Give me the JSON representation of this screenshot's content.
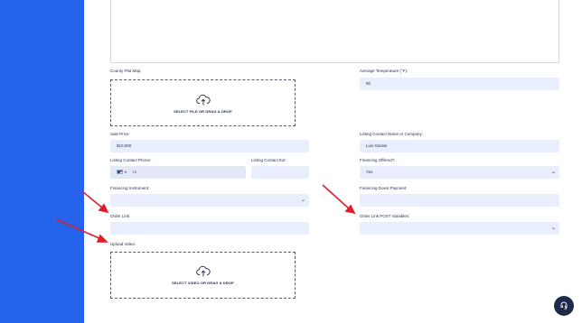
{
  "form": {
    "county_plat_map": {
      "label": "County Plat Map:",
      "dropzone_text": "SELECT FILE OR DRAG & DROP"
    },
    "average_temperature": {
      "label": "Average Temperature (°F):",
      "value": "90"
    },
    "sale_price": {
      "label": "Sale Price:",
      "value": "$10,000"
    },
    "listing_contact_name": {
      "label": "Listing Contact Name or Company:",
      "value": "Luis Garate"
    },
    "listing_contact_phone": {
      "label": "Listing Contact Phone:",
      "value": "+1",
      "country_flag": "us-flag-icon"
    },
    "listing_contact_ext": {
      "label": "Listing Contact Ext:",
      "value": ""
    },
    "financing_offered": {
      "label": "Financing Offered?:",
      "value": "Yes"
    },
    "financing_instrument": {
      "label": "Financing Instrument:",
      "value": ""
    },
    "financing_down_payment": {
      "label": "Financing Down Payment:",
      "value": ""
    },
    "order_link": {
      "label": "Order Link:",
      "value": ""
    },
    "order_link_post_variables": {
      "label": "Order Link POST Variables:",
      "value": ""
    },
    "upload_video": {
      "label": "Upload Video:",
      "dropzone_text": "SELECT VIDEO OR DRAG & DROP"
    }
  },
  "colors": {
    "sidebar": "#2563eb",
    "input_bg": "#e8eefc",
    "arrow": "#e11d2a",
    "chat_button": "#1e2a4a"
  },
  "icons": {
    "upload": "cloud-upload-icon",
    "chevron": "chevron-down-icon",
    "chat": "chat-support-icon",
    "annotation_arrow": "red-arrow-icon"
  }
}
